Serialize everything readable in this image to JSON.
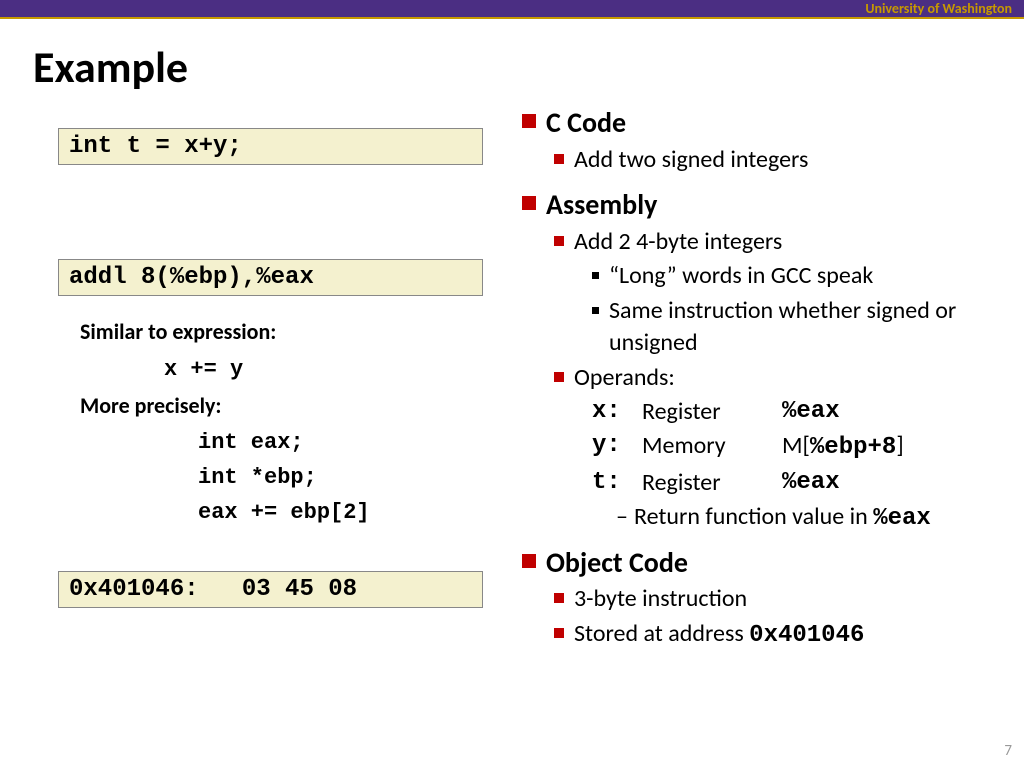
{
  "branding": "University of Washington",
  "title": "Example",
  "page_number": "7",
  "left": {
    "code_c": "int t = x+y;",
    "code_asm": "addl 8(%ebp),%eax",
    "similar_label": "Similar to expression:",
    "expr1": "x += y",
    "precise_label": "More precisely:",
    "decl1": "int eax;",
    "decl2": "int *ebp;",
    "decl3": "eax += ebp[2]",
    "code_obj": "0x401046:   03 45 08"
  },
  "right": {
    "h1_c": "C Code",
    "c_sub1": "Add two signed integers",
    "h1_asm": "Assembly",
    "asm_sub1": "Add 2 4-byte integers",
    "asm_sub1a": "“Long” words in GCC speak",
    "asm_sub1b": "Same instruction whether signed or unsigned",
    "asm_sub2": "Operands:",
    "op_x_name": "x:",
    "op_x_kind": "Register",
    "op_x_val": "%eax",
    "op_y_name": "y:",
    "op_y_kind": "Memory",
    "op_y_val_prefix": "M[",
    "op_y_val_inner": "%ebp+8",
    "op_y_val_suffix": "]",
    "op_t_name": "t:",
    "op_t_kind": "Register",
    "op_t_val": "%eax",
    "ret_line_pre": "Return function value in ",
    "ret_line_code": "%eax",
    "h1_obj": "Object Code",
    "obj_sub1": "3-byte instruction",
    "obj_sub2_pre": "Stored at address ",
    "obj_sub2_code": "0x401046"
  }
}
